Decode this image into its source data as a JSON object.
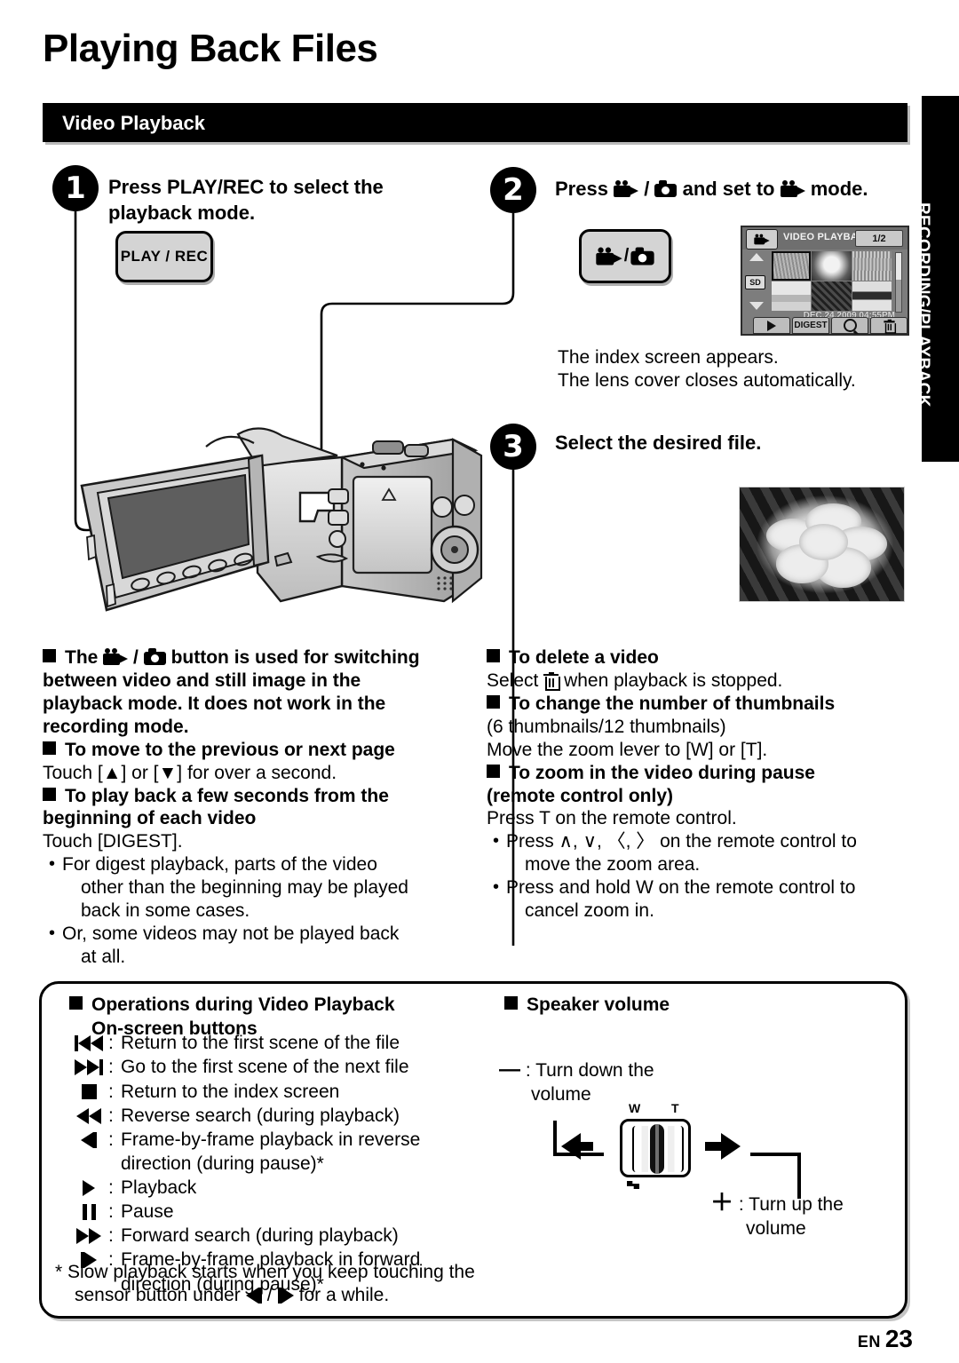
{
  "document": {
    "title": "Playing Back Files",
    "section_bar": "Video Playback",
    "side_tab": "RECORDING/PLAYBACK",
    "footer": {
      "locale": "EN",
      "page_number": "23"
    }
  },
  "steps": [
    {
      "number": "1",
      "heading_line1": "Press PLAY/REC to select the",
      "heading_line2": "playback mode.",
      "button_label": "PLAY / REC"
    },
    {
      "number": "2",
      "heading_prefix": "Press",
      "heading_mid": "/",
      "heading_middle": "and set to",
      "heading_suffix": "mode.",
      "note_line1": "The index screen appears.",
      "note_line2": "The lens cover closes automatically."
    },
    {
      "number": "3",
      "heading": "Select the desired file."
    }
  ],
  "index_screen": {
    "mode_icon": "video-camera-icon",
    "title": "VIDEO PLAYBACK",
    "page_indicator": "1/2",
    "card_label": "SD",
    "timestamp": "DEC.24.2009 04:55PM",
    "buttons": [
      {
        "name": "play-button",
        "label": ""
      },
      {
        "name": "digest-button",
        "label": "DIGEST"
      },
      {
        "name": "search-button",
        "label": ""
      },
      {
        "name": "delete-button",
        "label": ""
      }
    ],
    "thumbnails": [
      "grass-field",
      "white-flower",
      "tall-grass",
      "water-scene",
      "dark-foliage",
      "mountain-snow"
    ]
  },
  "notes_left": [
    {
      "type": "bold",
      "text": "The  ■ /  ■  button is used for switching"
    },
    {
      "type": "bold-cont",
      "text": "between video and still image in the"
    },
    {
      "type": "bold-cont",
      "text": "playback mode. It does not work in the"
    },
    {
      "type": "bold-cont",
      "text": "recording mode."
    },
    {
      "type": "bold",
      "text": "To move to the previous or next page"
    },
    {
      "type": "plain",
      "text": "Touch [▲] or [▼] for over a second."
    },
    {
      "type": "bold",
      "text": "To play back a few seconds from the"
    },
    {
      "type": "bold-cont",
      "text": "beginning of each video"
    },
    {
      "type": "plain",
      "text": "Touch [DIGEST]."
    },
    {
      "type": "dot",
      "text": "For digest playback, parts of the video"
    },
    {
      "type": "dot-cont",
      "text": "other than the beginning may be played"
    },
    {
      "type": "dot-cont",
      "text": "back in some cases."
    },
    {
      "type": "dot",
      "text": "Or, some videos may not be played back"
    },
    {
      "type": "dot-cont",
      "text": "at all."
    }
  ],
  "notes_left_headings": {
    "h1_prefix": "The",
    "h1_suffix": "button is used for switching",
    "h1_l2": "between video and still image in the",
    "h1_l3": "playback mode. It does not work in the",
    "h1_l4": "recording mode.",
    "h2": "To move to the previous or next page",
    "h2_body": "Touch [▲] or [▼] for over a second.",
    "h3_l1": "To play back a few seconds from the",
    "h3_l2": "beginning of each video",
    "h3_body": "Touch [DIGEST].",
    "d1_l1": "For digest playback, parts of the video",
    "d1_l2": "other than the beginning may be played",
    "d1_l3": "back in some cases.",
    "d2_l1": "Or, some videos may not be played back",
    "d2_l2": "at all."
  },
  "notes_right": {
    "h1": "To delete a video",
    "h1_body_prefix": "Select",
    "h1_body_suffix": "when playback is stopped.",
    "h2": "To change the number of thumbnails",
    "h2_body1": "(6 thumbnails/12 thumbnails)",
    "h2_body2": "Move the zoom lever to [W] or [T].",
    "h3_l1": "To zoom in the video during pause",
    "h3_l2": "(remote control only)",
    "h3_body": "Press T on the remote control.",
    "d1_l1": "Press ∧, ∨, 〈, 〉 on the remote control to",
    "d1_l2": "move the zoom area.",
    "d2_l1": "Press and hold W on the remote control to",
    "d2_l2": "cancel zoom in."
  },
  "bottom_box": {
    "operations_heading_l1": "Operations during Video Playback",
    "operations_heading_l2": "On-screen buttons",
    "operations": [
      {
        "glyph": "skip-back-icon",
        "text": "Return to the first scene of the file"
      },
      {
        "glyph": "skip-forward-icon",
        "text": "Go to the first scene of the next file"
      },
      {
        "glyph": "stop-icon",
        "text": "Return to the index screen"
      },
      {
        "glyph": "rewind-icon",
        "text": "Reverse search (during playback)"
      },
      {
        "glyph": "frame-reverse-icon",
        "text": "Frame-by-frame playback in reverse",
        "cont": "direction (during pause)*"
      },
      {
        "glyph": "play-icon",
        "text": "Playback"
      },
      {
        "glyph": "pause-icon",
        "text": "Pause"
      },
      {
        "glyph": "fast-forward-icon",
        "text": "Forward search (during playback)"
      },
      {
        "glyph": "frame-forward-icon",
        "text": "Frame-by-frame playback in forward",
        "cont": "direction (during pause)*"
      }
    ],
    "footnote_l1": "* Slow playback starts when you keep touching the",
    "footnote_l2_prefix": "sensor button under",
    "footnote_l2_mid": "/",
    "footnote_l2_suffix": "for a while.",
    "speaker_heading": "Speaker volume",
    "volume_down_symbol": "—",
    "volume_down_l1": ": Turn down the",
    "volume_down_l2": "volume",
    "volume_up_symbol": "＋",
    "volume_up_l1": ": Turn up the",
    "volume_up_l2": "volume",
    "lever_w": "W",
    "lever_t": "T"
  },
  "colors": {
    "accent_black": "#000000",
    "button_gray": "#d4d4d4",
    "lcd_gray": "#7d7d7d"
  }
}
